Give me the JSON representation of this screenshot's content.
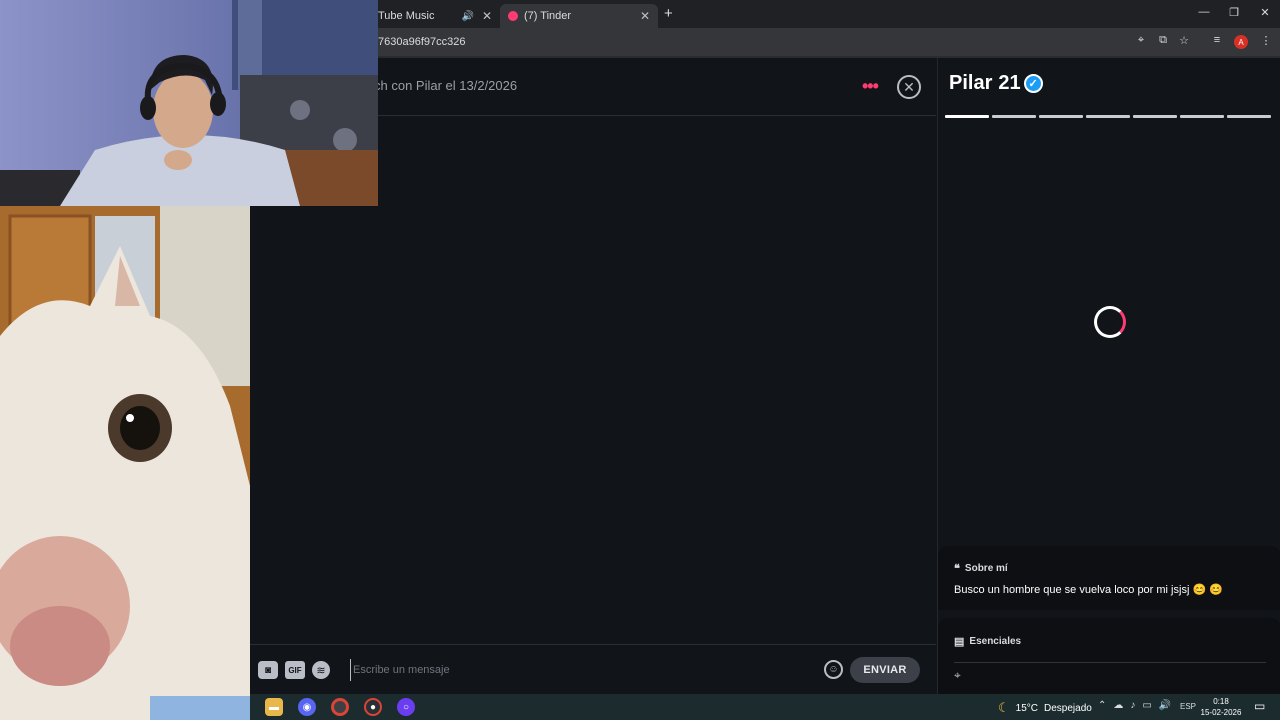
{
  "browser": {
    "tabs": [
      {
        "label": "Tube Music",
        "audio_icon": "speaker-icon"
      },
      {
        "label": "(7) Tinder",
        "active": true
      }
    ],
    "url": "7630a96f97cc326",
    "window_controls": {
      "minimize": "—",
      "restore": "❐",
      "close": "✕"
    }
  },
  "chat": {
    "match_text": "ch con Pilar el 13/2/2026",
    "composer": {
      "placeholder": "Escribe un mensaje",
      "gif_label": "GIF",
      "send_label": "ENVIAR"
    }
  },
  "profile": {
    "name": "Pilar",
    "age": "21",
    "verified": true,
    "photo_count": 7,
    "active_photo": 1,
    "about_title": "Sobre mí",
    "about_text": "Busco un hombre que se vuelva loco por mi jsjsj 😊 😊",
    "essentials_title": "Esenciales"
  },
  "taskbar": {
    "weather_temp": "15°C",
    "weather_desc": "Despejado",
    "language": "ESP",
    "time": "0:18",
    "date": "15-02-2026"
  },
  "colors": {
    "accent": "#fe3c72",
    "verified": "#1c9df5",
    "background": "#111418",
    "button": "#3b4049"
  }
}
